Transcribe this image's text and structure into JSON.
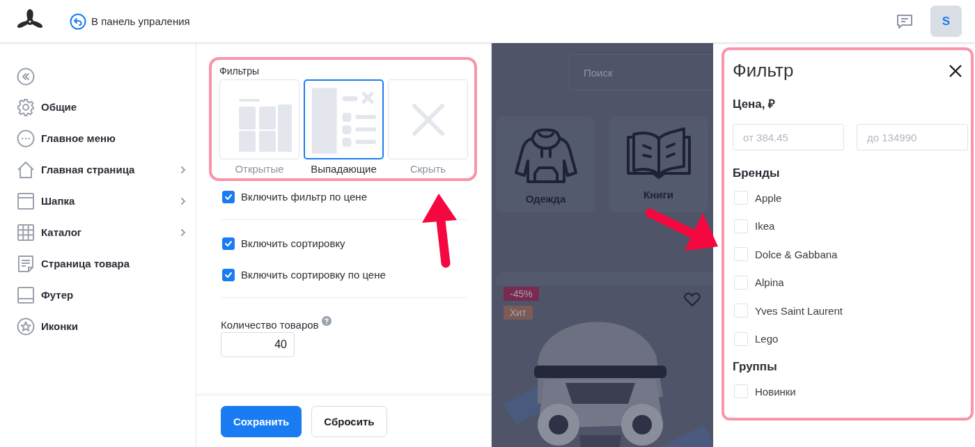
{
  "header": {
    "back_link": "В панель упраления",
    "avatar": "S"
  },
  "sidebar": {
    "items": [
      {
        "label": "Общие",
        "kind": "gear",
        "submenu": false
      },
      {
        "label": "Главное меню",
        "kind": "dots",
        "submenu": false
      },
      {
        "label": "Главная страница",
        "kind": "home",
        "submenu": true
      },
      {
        "label": "Шапка",
        "kind": "window",
        "submenu": true
      },
      {
        "label": "Каталог",
        "kind": "grid",
        "submenu": true
      },
      {
        "label": "Страница товара",
        "kind": "page",
        "submenu": false
      },
      {
        "label": "Футер",
        "kind": "footer",
        "submenu": false
      },
      {
        "label": "Иконки",
        "kind": "star",
        "submenu": false
      }
    ]
  },
  "settings": {
    "filters_label": "Фильтры",
    "filter_modes": [
      {
        "label": "Открытые",
        "kind": "open",
        "selected": false
      },
      {
        "label": "Выпадающие",
        "kind": "dropdown",
        "selected": true
      },
      {
        "label": "Скрыть",
        "kind": "hide",
        "selected": false
      }
    ],
    "option_groups": [
      [
        {
          "label": "Включить фильтр по цене",
          "checked": true
        }
      ],
      [
        {
          "label": "Включить сортировку",
          "checked": true
        },
        {
          "label": "Включить сортировку по цене",
          "checked": true
        }
      ]
    ],
    "quantity_label": "Количество товаров",
    "quantity_value": "40",
    "buttons": [
      {
        "label": "Сохранить",
        "kind": "primary"
      },
      {
        "label": "Сбросить",
        "kind": "secondary"
      }
    ]
  },
  "preview": {
    "search_placeholder": "Поиск",
    "categories": [
      {
        "label": "Одежда",
        "kind": "hoodie"
      },
      {
        "label": "Книги",
        "kind": "book"
      }
    ],
    "product": {
      "badges": [
        {
          "text": "-45%",
          "color": "#7a2a4e"
        },
        {
          "text": "Хит",
          "color": "#7d5a55"
        }
      ],
      "favorite": false
    }
  },
  "drawer": {
    "title": "Фильтр",
    "price_label": "Цена, ₽",
    "price_from_placeholder": "от 384.45",
    "price_to_placeholder": "до 134990",
    "sections": [
      {
        "title": "Бренды",
        "items": [
          {
            "label": "Apple",
            "checked": false
          },
          {
            "label": "Ikea",
            "checked": false
          },
          {
            "label": "Dolce & Gabbana",
            "checked": false
          },
          {
            "label": "Alpina",
            "checked": false
          },
          {
            "label": "Yves Saint Laurent",
            "checked": false
          },
          {
            "label": "Lego",
            "checked": false
          }
        ]
      },
      {
        "title": "Группы",
        "items": [
          {
            "label": "Новинки",
            "checked": false
          }
        ]
      }
    ]
  }
}
